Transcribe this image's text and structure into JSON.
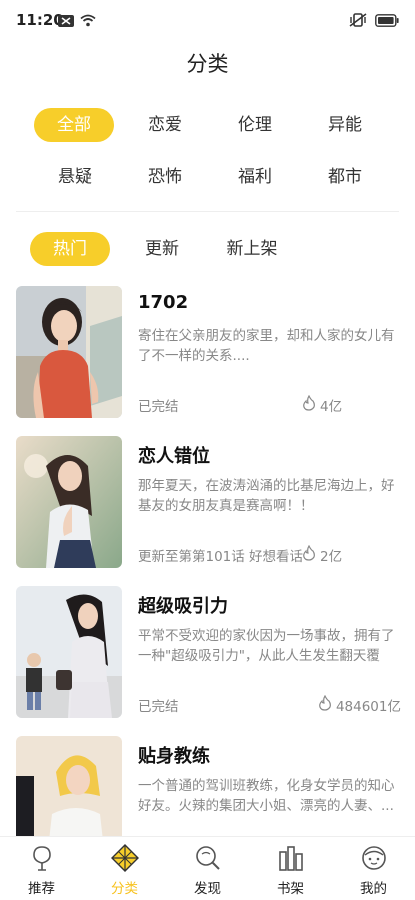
{
  "status_bar": {
    "time": "11:20"
  },
  "header": {
    "title": "分类"
  },
  "categories": [
    {
      "label": "全部",
      "active": true
    },
    {
      "label": "恋爱",
      "active": false
    },
    {
      "label": "伦理",
      "active": false
    },
    {
      "label": "异能",
      "active": false
    },
    {
      "label": "悬疑",
      "active": false
    },
    {
      "label": "恐怖",
      "active": false
    },
    {
      "label": "福利",
      "active": false
    },
    {
      "label": "都市",
      "active": false
    }
  ],
  "sort_tabs": [
    {
      "label": "热门",
      "active": true
    },
    {
      "label": "更新",
      "active": false
    },
    {
      "label": "新上架",
      "active": false
    }
  ],
  "comics": [
    {
      "title": "1702",
      "description": "寄住在父亲朋友的家里，却和人家的女儿有了不一样的关系....",
      "status": "已完结",
      "views": "4亿"
    },
    {
      "title": "恋人错位",
      "description": "那年夏天，在波涛汹涌的比基尼海边上，好基友的女朋友真是赛高啊！！",
      "status": "更新至第第101话 好想看话",
      "views": "2亿"
    },
    {
      "title": "超级吸引力",
      "description": "平常不受欢迎的家伙因为一场事故，拥有了一种\"超级吸引力\"，从此人生发生翻天覆地...",
      "status": "已完结",
      "views": "484601亿"
    },
    {
      "title": "贴身教练",
      "description": "一个普通的驾训班教练，化身女学员的知心好友。火辣的集团大小姐、漂亮的人妻、..."
    }
  ],
  "bottom_nav": [
    {
      "label": "推荐",
      "icon": "recommend-icon",
      "active": false
    },
    {
      "label": "分类",
      "icon": "category-icon",
      "active": true
    },
    {
      "label": "发现",
      "icon": "discover-icon",
      "active": false
    },
    {
      "label": "书架",
      "icon": "bookshelf-icon",
      "active": false
    },
    {
      "label": "我的",
      "icon": "profile-icon",
      "active": false
    }
  ],
  "colors": {
    "accent": "#f7ce2a",
    "text_primary": "#111111",
    "text_secondary": "#888888"
  }
}
